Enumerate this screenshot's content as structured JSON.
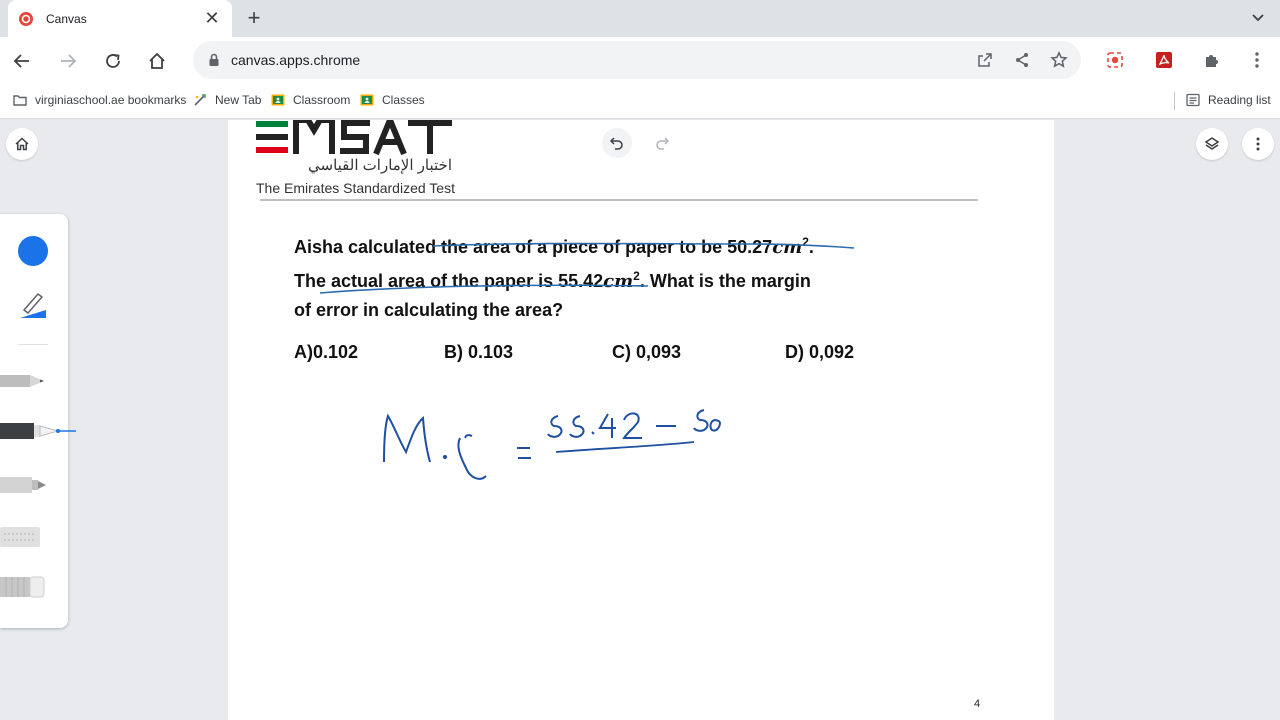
{
  "tab": {
    "title": "Canvas",
    "close": "✕"
  },
  "new_tab": "+",
  "omnibox": {
    "url": "canvas.apps.chrome"
  },
  "bookmarks": [
    {
      "label": "virginiaschool.ae bookmarks"
    },
    {
      "label": "New Tab"
    },
    {
      "label": "Classroom"
    },
    {
      "label": "Classes"
    }
  ],
  "reading_list": "Reading list",
  "palette": {
    "selected_color": "#1a73e8"
  },
  "document": {
    "logo_brand": "EMSAT",
    "logo_arabic": "اختبار الإمارات القياسي",
    "logo_subtitle": "The Emirates Standardized Test",
    "question_line1_text": "Aisha calculated the area of a piece of paper to be 50.27",
    "question_line1_unit": "cm",
    "question_line1_end": ".",
    "question_line2_text": "The actual area of the paper is 55.42",
    "question_line2_unit": "cm",
    "question_line2_end": ". What is the margin",
    "question_line3": "of error in calculating the area?",
    "exponent": "2",
    "choices": [
      "A)0.102",
      "B) 0.103",
      "C) 0,093",
      "D) 0,092"
    ],
    "page_number": "4"
  },
  "ink_color": "#1f4fa0",
  "underline_color": "#2b6cb0"
}
